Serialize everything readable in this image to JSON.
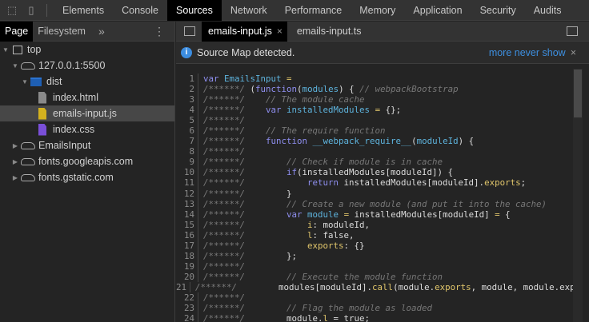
{
  "topbar": {
    "tabs": [
      "Elements",
      "Console",
      "Sources",
      "Network",
      "Performance",
      "Memory",
      "Application",
      "Security",
      "Audits"
    ],
    "active": "Sources"
  },
  "navigator": {
    "tabs": {
      "page": "Page",
      "filesystem": "Filesystem"
    },
    "more": "»",
    "menu": "⋮",
    "tree": [
      {
        "label": "top",
        "icon": "frame-icon",
        "depth": 0,
        "arrow": "▼"
      },
      {
        "label": "127.0.0.1:5500",
        "icon": "cloud-icon",
        "depth": 1,
        "arrow": "▼"
      },
      {
        "label": "dist",
        "icon": "folder-icon",
        "depth": 2,
        "arrow": "▼"
      },
      {
        "label": "index.html",
        "icon": "file-icon",
        "depth": 3,
        "arrow": "",
        "color": "#8a8a8a"
      },
      {
        "label": "emails-input.js",
        "icon": "file-icon",
        "depth": 3,
        "arrow": "",
        "color": "#d4b11e",
        "selected": true
      },
      {
        "label": "index.css",
        "icon": "file-icon",
        "depth": 3,
        "arrow": "",
        "color": "#7a4fd8"
      },
      {
        "label": "EmailsInput",
        "icon": "cloud-icon",
        "depth": 1,
        "arrow": "▶"
      },
      {
        "label": "fonts.googleapis.com",
        "icon": "cloud-icon",
        "depth": 1,
        "arrow": "▶"
      },
      {
        "label": "fonts.gstatic.com",
        "icon": "cloud-icon",
        "depth": 1,
        "arrow": "▶"
      }
    ]
  },
  "editor": {
    "tabs": [
      "emails-input.js",
      "emails-input.ts"
    ],
    "close": "×",
    "infobar": {
      "icon": "i",
      "message": "Source Map detected.",
      "link": "more never show",
      "close": "×"
    },
    "lines": [
      [
        [
          "var ",
          "k"
        ],
        [
          "EmailsInput ",
          "v"
        ],
        [
          "=",
          "p"
        ]
      ],
      [
        [
          "/******/",
          "g"
        ],
        [
          " (",
          "d"
        ],
        [
          "function",
          "k"
        ],
        [
          "(",
          "d"
        ],
        [
          "modules",
          "v"
        ],
        [
          ") { ",
          "d"
        ],
        [
          "// webpackBootstrap",
          "c"
        ]
      ],
      [
        [
          "/******/",
          "g"
        ],
        [
          "    ",
          "d"
        ],
        [
          "// The module cache",
          "c"
        ]
      ],
      [
        [
          "/******/",
          "g"
        ],
        [
          "    ",
          "d"
        ],
        [
          "var ",
          "k"
        ],
        [
          "installedModules ",
          "v"
        ],
        [
          "= ",
          "p"
        ],
        [
          "{};",
          "d"
        ]
      ],
      [
        [
          "/******/",
          "g"
        ]
      ],
      [
        [
          "/******/",
          "g"
        ],
        [
          "    ",
          "d"
        ],
        [
          "// The require function",
          "c"
        ]
      ],
      [
        [
          "/******/",
          "g"
        ],
        [
          "    ",
          "d"
        ],
        [
          "function ",
          "k"
        ],
        [
          "__webpack_require__",
          "v"
        ],
        [
          "(",
          "d"
        ],
        [
          "moduleId",
          "v"
        ],
        [
          ") {",
          "d"
        ]
      ],
      [
        [
          "/******/",
          "g"
        ]
      ],
      [
        [
          "/******/",
          "g"
        ],
        [
          "        ",
          "d"
        ],
        [
          "// Check if module is in cache",
          "c"
        ]
      ],
      [
        [
          "/******/",
          "g"
        ],
        [
          "        ",
          "d"
        ],
        [
          "if",
          "k"
        ],
        [
          "(installedModules[moduleId]) {",
          "d"
        ]
      ],
      [
        [
          "/******/",
          "g"
        ],
        [
          "            ",
          "d"
        ],
        [
          "return ",
          "k"
        ],
        [
          "installedModules[moduleId].",
          "d"
        ],
        [
          "exports",
          "p"
        ],
        [
          ";",
          "d"
        ]
      ],
      [
        [
          "/******/",
          "g"
        ],
        [
          "        }",
          "d"
        ]
      ],
      [
        [
          "/******/",
          "g"
        ],
        [
          "        ",
          "d"
        ],
        [
          "// Create a new module (and put it into the cache)",
          "c"
        ]
      ],
      [
        [
          "/******/",
          "g"
        ],
        [
          "        ",
          "d"
        ],
        [
          "var ",
          "k"
        ],
        [
          "module ",
          "v"
        ],
        [
          "= ",
          "p"
        ],
        [
          "installedModules[moduleId] ",
          "d"
        ],
        [
          "= ",
          "p"
        ],
        [
          "{",
          "d"
        ]
      ],
      [
        [
          "/******/",
          "g"
        ],
        [
          "            ",
          "d"
        ],
        [
          "i",
          "p"
        ],
        [
          ": moduleId,",
          "d"
        ]
      ],
      [
        [
          "/******/",
          "g"
        ],
        [
          "            ",
          "d"
        ],
        [
          "l",
          "p"
        ],
        [
          ": false,",
          "d"
        ]
      ],
      [
        [
          "/******/",
          "g"
        ],
        [
          "            ",
          "d"
        ],
        [
          "exports",
          "p"
        ],
        [
          ": {}",
          "d"
        ]
      ],
      [
        [
          "/******/",
          "g"
        ],
        [
          "        };",
          "d"
        ]
      ],
      [
        [
          "/******/",
          "g"
        ]
      ],
      [
        [
          "/******/",
          "g"
        ],
        [
          "        ",
          "d"
        ],
        [
          "// Execute the module function",
          "c"
        ]
      ],
      [
        [
          "/******/",
          "g"
        ],
        [
          "        modules[moduleId].",
          "d"
        ],
        [
          "call",
          "p"
        ],
        [
          "(module.",
          "d"
        ],
        [
          "exports",
          "p"
        ],
        [
          ", module, module.exports, __webpack_require__);",
          "d"
        ]
      ],
      [
        [
          "/******/",
          "g"
        ]
      ],
      [
        [
          "/******/",
          "g"
        ],
        [
          "        ",
          "d"
        ],
        [
          "// Flag the module as loaded",
          "c"
        ]
      ],
      [
        [
          "/******/",
          "g"
        ],
        [
          "        module.",
          "d"
        ],
        [
          "l",
          "p"
        ],
        [
          " = true;",
          "d"
        ]
      ],
      [
        [
          "/******/",
          "g"
        ]
      ]
    ]
  }
}
